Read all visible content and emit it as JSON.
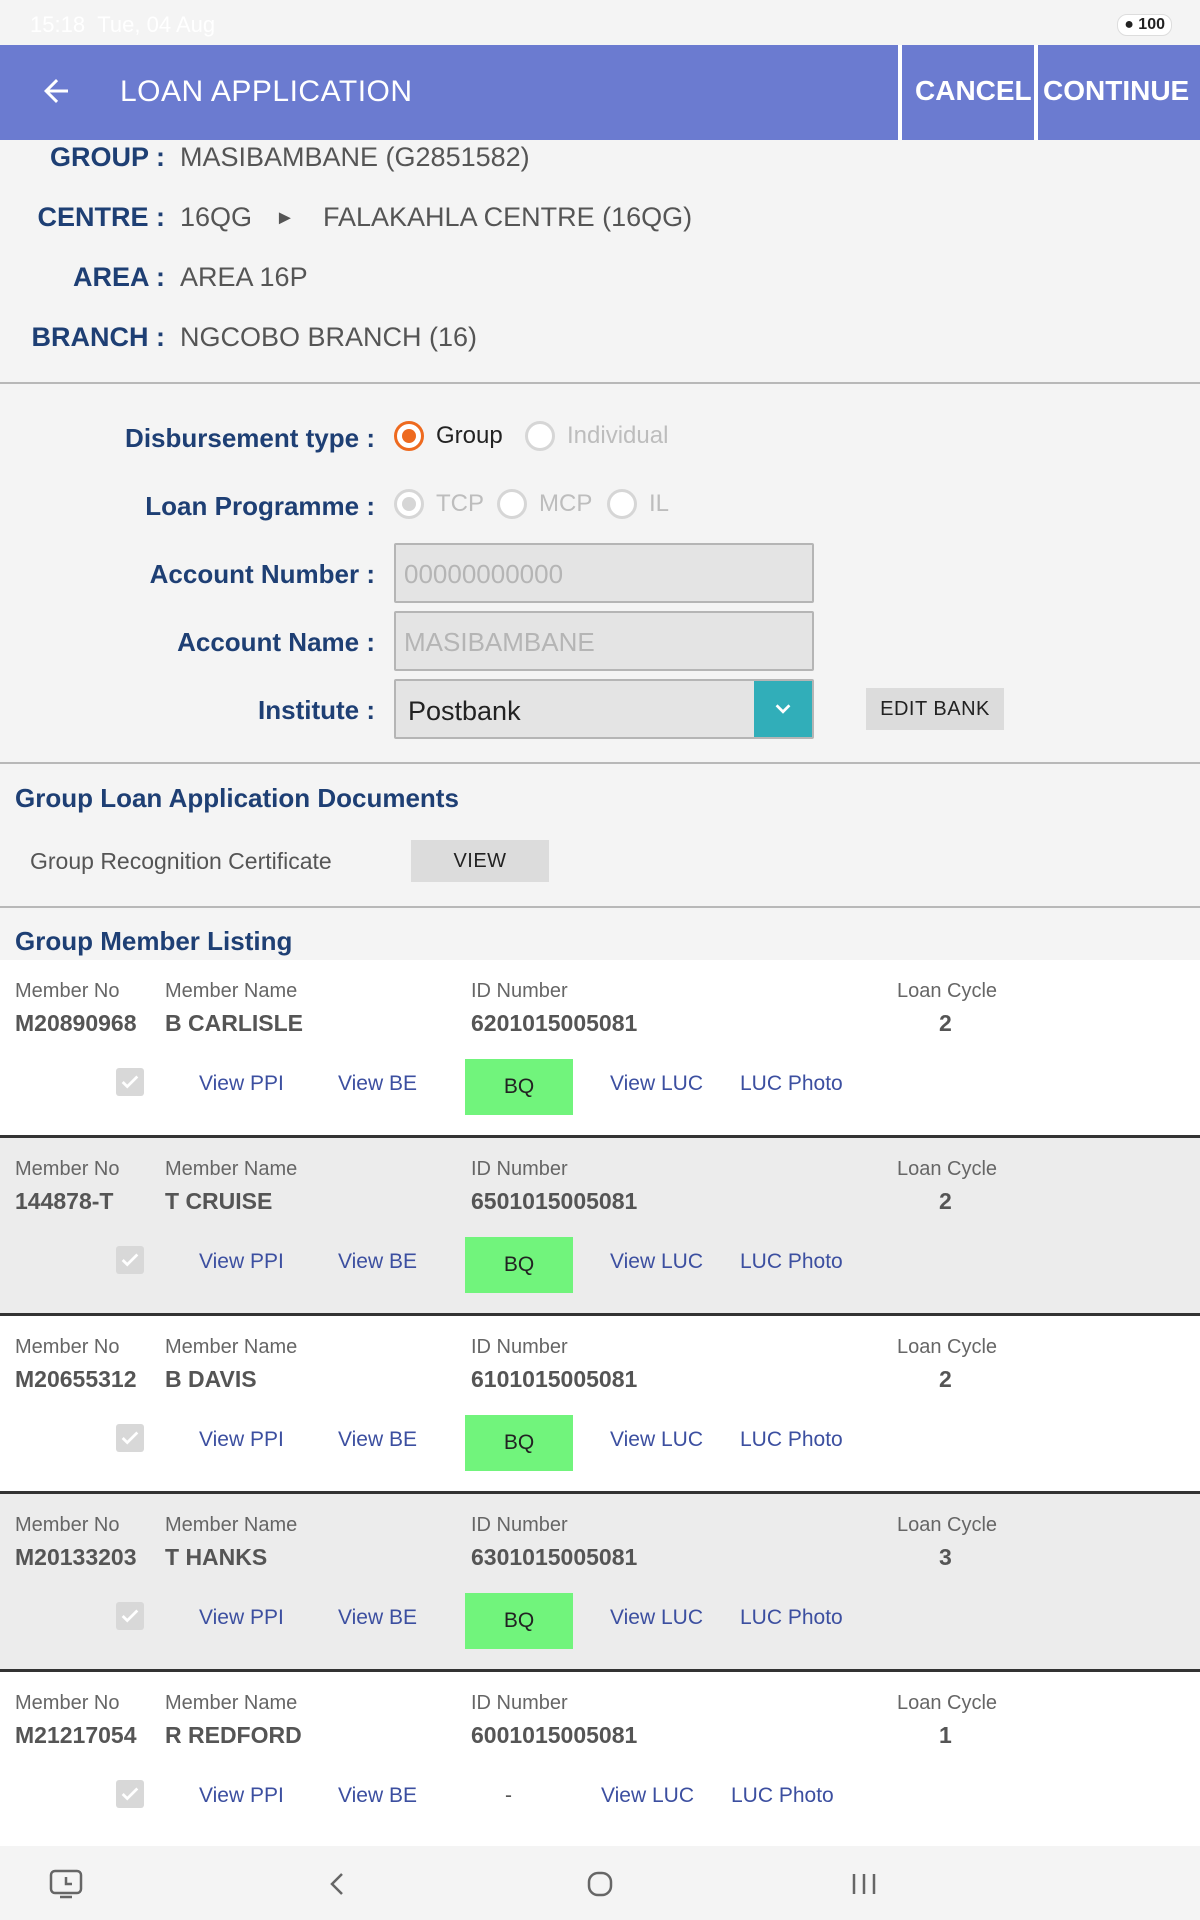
{
  "status": {
    "time": "15:18",
    "date": "Tue, 04 Aug",
    "battery": "100"
  },
  "appbar": {
    "title": "LOAN APPLICATION",
    "cancel": "CANCEL",
    "continue": "CONTINUE"
  },
  "info": {
    "group": {
      "label": "GROUP :",
      "value": "MASIBAMBANE (G2851582)"
    },
    "centre": {
      "label": "CENTRE :",
      "code": "16QG",
      "arrow": "►",
      "name": "FALAKAHLA CENTRE (16QG)"
    },
    "area": {
      "label": "AREA :",
      "value": "AREA 16P"
    },
    "branch": {
      "label": "BRANCH :",
      "value": "NGCOBO BRANCH (16)"
    }
  },
  "form": {
    "disbursement": {
      "label": "Disbursement type :",
      "options": [
        {
          "label": "Group",
          "selected": true,
          "disabled": false
        },
        {
          "label": "Individual",
          "selected": false,
          "disabled": true
        }
      ]
    },
    "programme": {
      "label": "Loan Programme :",
      "options": [
        {
          "label": "TCP",
          "selected": true
        },
        {
          "label": "MCP",
          "selected": false
        },
        {
          "label": "IL",
          "selected": false
        }
      ]
    },
    "account_number": {
      "label": "Account Number :",
      "value": "00000000000"
    },
    "account_name": {
      "label": "Account Name :",
      "value": "MASIBAMBANE"
    },
    "institute": {
      "label": "Institute :",
      "value": "Postbank"
    },
    "edit_bank": "EDIT BANK"
  },
  "documents": {
    "title": "Group Loan Application Documents",
    "item": "Group Recognition Certificate",
    "view": "VIEW"
  },
  "listing": {
    "title": "Group Member Listing",
    "headers": {
      "member_no": "Member No",
      "member_name": "Member Name",
      "id_number": "ID Number",
      "loan_cycle": "Loan Cycle"
    },
    "links": {
      "ppi": "View PPI",
      "be": "View BE",
      "bq": "BQ",
      "luc": "View LUC",
      "luc_photo": "LUC Photo"
    },
    "members": [
      {
        "no": "M20890968",
        "name": "B CARLISLE",
        "id": "6201015005081",
        "cycle": "2",
        "bq": "BQ"
      },
      {
        "no": "144878-T",
        "name": "T CRUISE",
        "id": "6501015005081",
        "cycle": "2",
        "bq": "BQ"
      },
      {
        "no": "M20655312",
        "name": "B DAVIS",
        "id": "6101015005081",
        "cycle": "2",
        "bq": "BQ"
      },
      {
        "no": "M20133203",
        "name": "T HANKS",
        "id": "6301015005081",
        "cycle": "3",
        "bq": "BQ"
      },
      {
        "no": "M21217054",
        "name": "R REDFORD",
        "id": "6001015005081",
        "cycle": "1",
        "bq": "-"
      }
    ]
  },
  "colors": {
    "appbar": "#6b7bd0",
    "label": "#1e3f74",
    "radio_on": "#ee6a1f",
    "bq": "#71f47c",
    "caret": "#31aeb9",
    "link": "#3c4fa0"
  }
}
